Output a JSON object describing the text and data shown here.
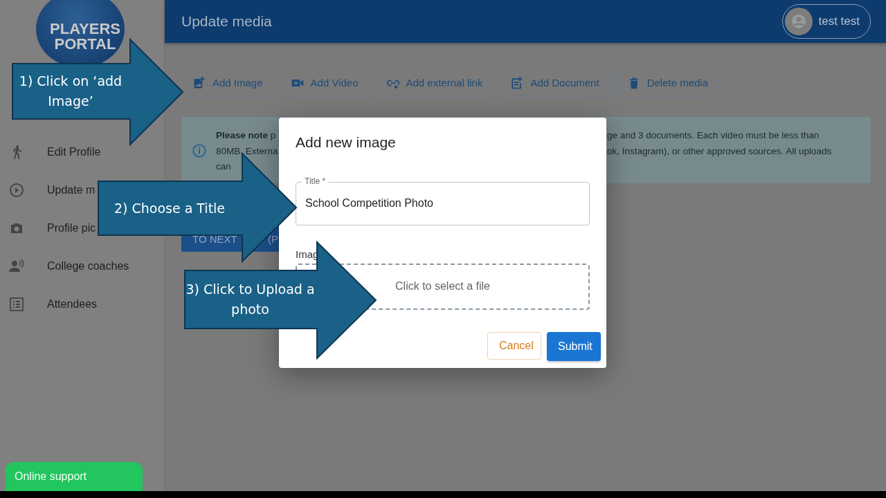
{
  "logo": {
    "line_1": "PLAYERS",
    "line_2": "PORTAL"
  },
  "sidebar": {
    "items": [
      {
        "label": "Edit Profile"
      },
      {
        "label": "Update m"
      },
      {
        "label": "Profile pic"
      },
      {
        "label": "College coaches"
      },
      {
        "label": "Attendees"
      }
    ]
  },
  "support_button": "Online support",
  "header": {
    "title": "Update media",
    "user": "test test"
  },
  "toolbar": [
    {
      "label": "Add Image"
    },
    {
      "label": "Add Video"
    },
    {
      "label": "Add external link"
    },
    {
      "label": "Add Document"
    },
    {
      "label": "Delete media"
    }
  ],
  "notice": {
    "left_lines": [
      "**Please note** p",
      "80MB. Externa",
      "can"
    ],
    "right_lines": [
      "ge and 3 documents. Each video must be less than",
      "ok, Instagram), or other approved sources. All uploads"
    ]
  },
  "next_button": {
    "text_parts": [
      "TO NEXT",
      "(P"
    ]
  },
  "dialog": {
    "title": "Add new image",
    "title_field": {
      "label": "Title *",
      "value": "School Competition Photo"
    },
    "image_label": "Imag",
    "upload": {
      "placeholder": "Click to select a file"
    },
    "buttons": [
      {
        "label": "Cancel",
        "kind": "secondary"
      },
      {
        "label": "Submit",
        "kind": "primary"
      }
    ]
  },
  "callouts": [
    {
      "text": "1) Click on ‘add Image’"
    },
    {
      "text": "2) Choose a Title"
    },
    {
      "text": "3) Click to Upload a photo"
    }
  ]
}
